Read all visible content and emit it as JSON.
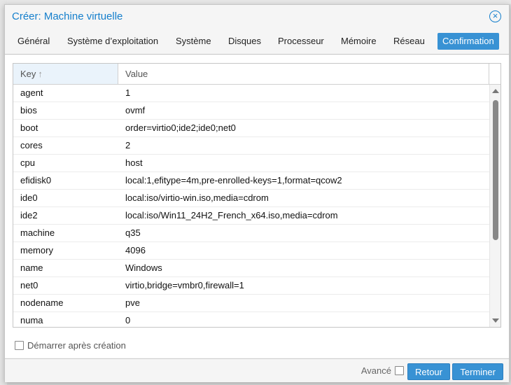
{
  "window": {
    "title": "Créer: Machine virtuelle"
  },
  "tabs": [
    {
      "label": "Général"
    },
    {
      "label": "Système d’exploitation"
    },
    {
      "label": "Système"
    },
    {
      "label": "Disques"
    },
    {
      "label": "Processeur"
    },
    {
      "label": "Mémoire"
    },
    {
      "label": "Réseau"
    },
    {
      "label": "Confirmation",
      "active": true
    }
  ],
  "grid": {
    "columns": {
      "key": "Key",
      "value": "Value"
    },
    "rows": [
      {
        "key": "agent",
        "value": "1"
      },
      {
        "key": "bios",
        "value": "ovmf"
      },
      {
        "key": "boot",
        "value": "order=virtio0;ide2;ide0;net0"
      },
      {
        "key": "cores",
        "value": "2"
      },
      {
        "key": "cpu",
        "value": "host"
      },
      {
        "key": "efidisk0",
        "value": "local:1,efitype=4m,pre-enrolled-keys=1,format=qcow2"
      },
      {
        "key": "ide0",
        "value": "local:iso/virtio-win.iso,media=cdrom"
      },
      {
        "key": "ide2",
        "value": "local:iso/Win11_24H2_French_x64.iso,media=cdrom"
      },
      {
        "key": "machine",
        "value": "q35"
      },
      {
        "key": "memory",
        "value": "4096"
      },
      {
        "key": "name",
        "value": "Windows"
      },
      {
        "key": "net0",
        "value": "virtio,bridge=vmbr0,firewall=1"
      },
      {
        "key": "nodename",
        "value": "pve"
      },
      {
        "key": "numa",
        "value": "0"
      }
    ]
  },
  "options": {
    "start_after_create": "Démarrer après création",
    "start_after_create_checked": false
  },
  "footer": {
    "advanced_label": "Avancé",
    "advanced_checked": false,
    "back_label": "Retour",
    "finish_label": "Terminer"
  },
  "colors": {
    "accent": "#3892d4",
    "title": "#157fcc"
  },
  "icons": {
    "close": "close-circle-icon",
    "sort": "sort-ascending-icon"
  }
}
